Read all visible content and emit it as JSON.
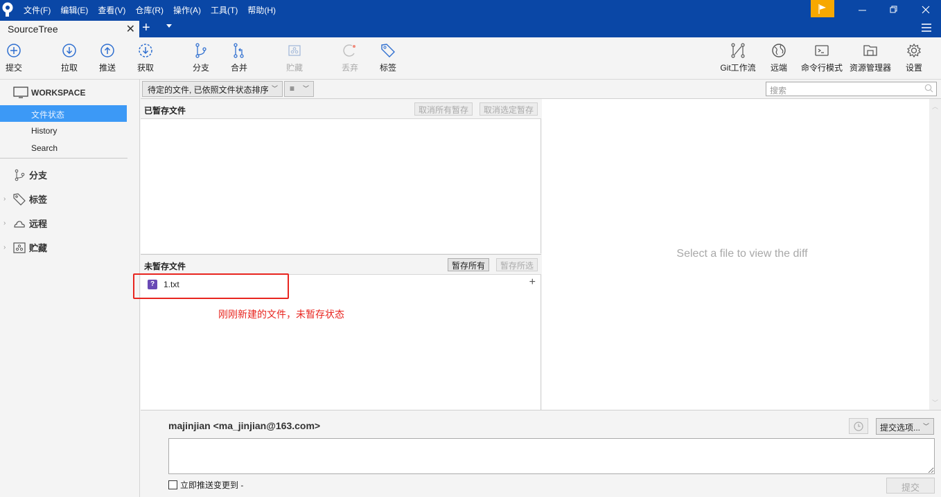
{
  "app": {
    "menu": [
      "文件(F)",
      "编辑(E)",
      "查看(V)",
      "仓库(R)",
      "操作(A)",
      "工具(T)",
      "帮助(H)"
    ],
    "colors": {
      "titlebar": "#0a47a6",
      "flag": "#f7a800",
      "selection": "#3c99f6",
      "annotation": "#e8251f",
      "untracked_badge": "#6949b5"
    }
  },
  "tabs": [
    {
      "label": "SourceTree"
    }
  ],
  "toolbar": {
    "left": [
      {
        "label": "提交",
        "icon": "commit-icon",
        "disabled": false
      },
      {
        "label": "拉取",
        "icon": "pull-icon",
        "disabled": false
      },
      {
        "label": "推送",
        "icon": "push-icon",
        "disabled": false
      },
      {
        "label": "获取",
        "icon": "fetch-icon",
        "disabled": false
      },
      {
        "label": "分支",
        "icon": "branch-icon",
        "disabled": false
      },
      {
        "label": "合并",
        "icon": "merge-icon",
        "disabled": false
      },
      {
        "label": "贮藏",
        "icon": "stash-icon",
        "disabled": true
      },
      {
        "label": "丢弃",
        "icon": "discard-icon",
        "disabled": true
      },
      {
        "label": "标签",
        "icon": "tag-icon",
        "disabled": false
      }
    ],
    "right": [
      {
        "label": "Git工作流",
        "icon": "git-flow-icon"
      },
      {
        "label": "远端",
        "icon": "remote-globe-icon"
      },
      {
        "label": "命令行模式",
        "icon": "terminal-icon"
      },
      {
        "label": "资源管理器",
        "icon": "explorer-folder-icon"
      },
      {
        "label": "设置",
        "icon": "settings-gear-icon"
      }
    ]
  },
  "sidebar": {
    "workspace_label": "WORKSPACE",
    "items": [
      {
        "label": "文件状态",
        "active": true
      },
      {
        "label": "History",
        "active": false
      },
      {
        "label": "Search",
        "active": false
      }
    ],
    "groups": [
      {
        "label": "分支",
        "expandable": false
      },
      {
        "label": "标签",
        "expandable": true
      },
      {
        "label": "远程",
        "expandable": true
      },
      {
        "label": "贮藏",
        "expandable": true
      }
    ]
  },
  "filter": {
    "sort_select": "待定的文件, 已依照文件状态排序",
    "view_select": "≡",
    "search_placeholder": "搜索"
  },
  "staged": {
    "title": "已暂存文件",
    "unstage_all": "取消所有暂存",
    "unstage_selected": "取消选定暂存",
    "files": []
  },
  "unstaged": {
    "title": "未暂存文件",
    "stage_all": "暂存所有",
    "stage_selected": "暂存所选",
    "files": [
      {
        "name": "1.txt",
        "status": "untracked",
        "badge": "?"
      }
    ]
  },
  "annotation": "刚刚新建的文件，未暂存状态",
  "diff": {
    "placeholder": "Select a file to view the diff"
  },
  "commit": {
    "author": "majinjian <ma_jinjian@163.com>",
    "message": "",
    "push_immediately_label": "立即推送变更到 -",
    "push_immediately_checked": false,
    "options_label": "提交选项...",
    "commit_label": "提交"
  }
}
